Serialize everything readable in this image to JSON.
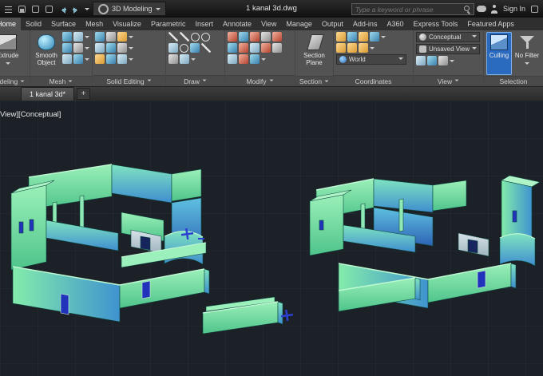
{
  "colors": {
    "accent_blue": "#2a6bc0",
    "wall_green": "#7fe9a9",
    "wall_teal": "#3f93cf",
    "door_blue": "#2233bb",
    "viewport_bg": "#1b2127"
  },
  "icons": {
    "search": "magnifier",
    "sign_in": "person",
    "workspace": "gear",
    "dropdown": "triangle-down",
    "culling": "blue-cube",
    "no_filter": "funnel"
  },
  "titlebar": {
    "workspace": "3D Modeling",
    "filename": "1 kanal 3d.dwg",
    "search_placeholder": "Type a keyword or phrase",
    "sign_in": "Sign In"
  },
  "ribbon": {
    "tabs": [
      "Home",
      "Solid",
      "Surface",
      "Mesh",
      "Visualize",
      "Parametric",
      "Insert",
      "Annotate",
      "View",
      "Manage",
      "Output",
      "Add-ins",
      "A360",
      "Express Tools",
      "Featured Apps"
    ],
    "active_tab": "Home",
    "panels": {
      "modeling": {
        "label": "Modeling",
        "extrude": "Extrude"
      },
      "mesh": {
        "label": "Mesh",
        "smooth_object": "Smooth Object"
      },
      "solid_editing": {
        "label": "Solid Editing"
      },
      "draw": {
        "label": "Draw"
      },
      "modify": {
        "label": "Modify"
      },
      "section": {
        "label": "Section",
        "section_plane": "Section Plane"
      },
      "coordinates": {
        "label": "Coordinates",
        "world": "World"
      },
      "view": {
        "label": "View",
        "visual_style": "Conceptual",
        "named_view": "Unsaved View"
      },
      "selection": {
        "label": "Selection",
        "culling": "Culling",
        "no_filter": "No Filter"
      }
    }
  },
  "filetabs": {
    "active": "1 kanal 3d*",
    "new_tab": "+"
  },
  "viewport": {
    "label": "View][Conceptual]"
  }
}
